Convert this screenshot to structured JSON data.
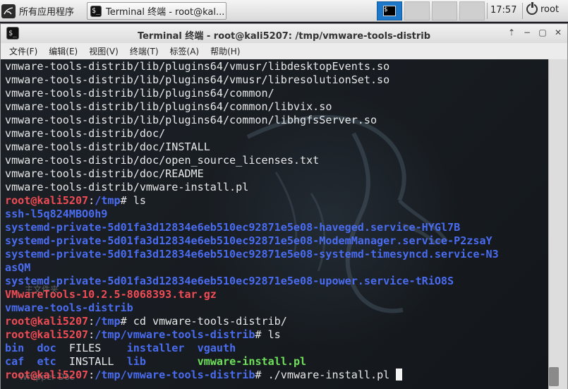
{
  "panel": {
    "apps_label": "所有应用程序",
    "task_label": "Terminal 终端 - root@kal...",
    "clock": "17:57",
    "user": "root"
  },
  "window": {
    "title": "Terminal 终端 - root@kali5207: /tmp/vmware-tools-distrib",
    "buttons": [
      "⇡",
      "−",
      "▢",
      "✕"
    ],
    "menu": [
      "文件(F)",
      "编辑(E)",
      "视图(V)",
      "终端(T)",
      "标签(A)",
      "帮助(H)"
    ]
  },
  "terminal": {
    "lines": [
      [
        {
          "t": "vmware-tools-distrib/lib/plugins64/vmusr/libdesktopEvents.so",
          "c": ""
        }
      ],
      [
        {
          "t": "vmware-tools-distrib/lib/plugins64/vmusr/libresolutionSet.so",
          "c": ""
        }
      ],
      [
        {
          "t": "vmware-tools-distrib/lib/plugins64/common/",
          "c": ""
        }
      ],
      [
        {
          "t": "vmware-tools-distrib/lib/plugins64/common/libvix.so",
          "c": ""
        }
      ],
      [
        {
          "t": "vmware-tools-distrib/lib/plugins64/common/libhgfsServer.so",
          "c": ""
        }
      ],
      [
        {
          "t": "vmware-tools-distrib/doc/",
          "c": ""
        }
      ],
      [
        {
          "t": "vmware-tools-distrib/doc/INSTALL",
          "c": ""
        }
      ],
      [
        {
          "t": "vmware-tools-distrib/doc/open_source_licenses.txt",
          "c": ""
        }
      ],
      [
        {
          "t": "vmware-tools-distrib/doc/README",
          "c": ""
        }
      ],
      [
        {
          "t": "vmware-tools-distrib/vmware-install.pl",
          "c": ""
        }
      ],
      [
        {
          "t": "root@kali5207",
          "c": "red"
        },
        {
          "t": ":",
          "c": ""
        },
        {
          "t": "/tmp",
          "c": "blue"
        },
        {
          "t": "# ls",
          "c": ""
        }
      ],
      [
        {
          "t": "ssh-l5q824MBO0h9",
          "c": "blue"
        }
      ],
      [
        {
          "t": "systemd-private-5d01fa3d12834e6eb510ec92871e5e08-haveged.service-HYGl7B",
          "c": "blue"
        }
      ],
      [
        {
          "t": "systemd-private-5d01fa3d12834e6eb510ec92871e5e08-ModemManager.service-P2zsaY",
          "c": "blue"
        }
      ],
      [
        {
          "t": "systemd-private-5d01fa3d12834e6eb510ec92871e5e08-systemd-timesyncd.service-N3",
          "c": "blue"
        }
      ],
      [
        {
          "t": "asQM",
          "c": "blue"
        }
      ],
      [
        {
          "t": "systemd-private-5d01fa3d12834e6eb510ec92871e5e08-upower.service-tRiO8S",
          "c": "blue"
        }
      ],
      [
        {
          "t": "VMwareTools-10.2.5-8068393.tar.gz",
          "c": "red"
        }
      ],
      [
        {
          "t": "vmware-tools-distrib",
          "c": "blue"
        }
      ],
      [
        {
          "t": "root@kali5207",
          "c": "red"
        },
        {
          "t": ":",
          "c": ""
        },
        {
          "t": "/tmp",
          "c": "blue"
        },
        {
          "t": "# cd vmware-tools-distrib/",
          "c": ""
        }
      ],
      [
        {
          "t": "root@kali5207",
          "c": "red"
        },
        {
          "t": ":",
          "c": ""
        },
        {
          "t": "/tmp/vmware-tools-distrib",
          "c": "blue"
        },
        {
          "t": "# ls",
          "c": ""
        }
      ],
      [
        {
          "t": "bin",
          "c": "blue"
        },
        {
          "t": "  ",
          "c": ""
        },
        {
          "t": "doc",
          "c": "blue"
        },
        {
          "t": "  FILES    ",
          "c": ""
        },
        {
          "t": "installer",
          "c": "blue"
        },
        {
          "t": "  ",
          "c": ""
        },
        {
          "t": "vgauth",
          "c": "blue"
        }
      ],
      [
        {
          "t": "caf",
          "c": "blue"
        },
        {
          "t": "  ",
          "c": ""
        },
        {
          "t": "etc",
          "c": "blue"
        },
        {
          "t": "  INSTALL  ",
          "c": ""
        },
        {
          "t": "lib",
          "c": "blue"
        },
        {
          "t": "        ",
          "c": ""
        },
        {
          "t": "vmware-install.pl",
          "c": "green"
        }
      ],
      [
        {
          "t": "root@kali5207",
          "c": "red"
        },
        {
          "t": ":",
          "c": ""
        },
        {
          "t": "/tmp/vmware-tools-distrib",
          "c": "blue"
        },
        {
          "t": "# ./vmware-install.pl ",
          "c": ""
        }
      ]
    ],
    "ghost_labels": [
      "主文件夹",
      "Wrapper Doc"
    ]
  }
}
